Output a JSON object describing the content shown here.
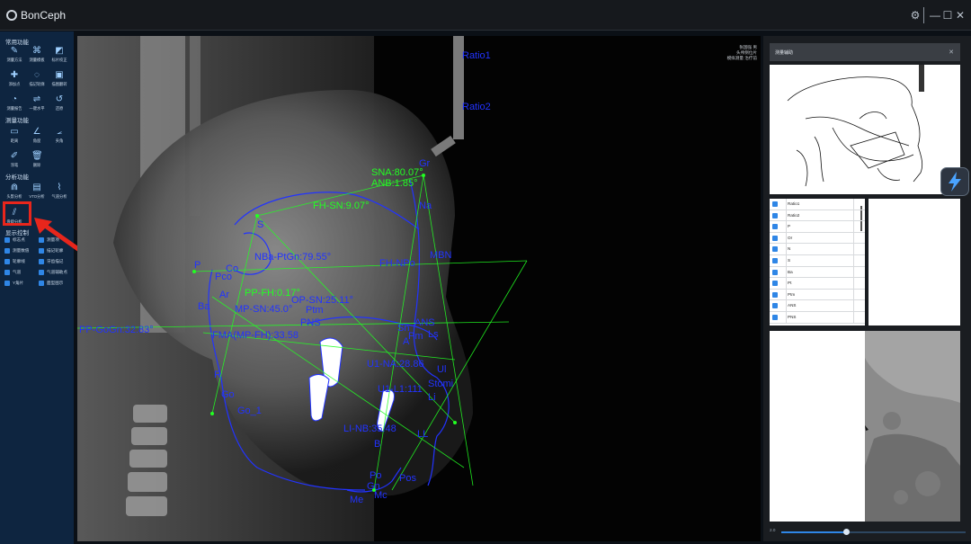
{
  "app": {
    "title": "BonCeph"
  },
  "window_controls": {
    "settings": "⚙",
    "minimize": "—",
    "maximize": "☐",
    "close": "✕"
  },
  "sidebar": {
    "sections": [
      {
        "title": "常用功能",
        "tools": [
          {
            "label": "测量方法",
            "icon": "ruler-set-icon"
          },
          {
            "label": "测量模板",
            "icon": "template-icon"
          },
          {
            "label": "标片校正",
            "icon": "calibrate-icon"
          },
          {
            "label": "添加点",
            "icon": "add-point-icon"
          },
          {
            "label": "描记轮廓",
            "icon": "contour-icon"
          },
          {
            "label": "描图翻转",
            "icon": "flip-icon"
          },
          {
            "label": "测量报告",
            "icon": "report-icon"
          },
          {
            "label": "一键水平",
            "icon": "level-icon"
          },
          {
            "label": "还原",
            "icon": "restore-icon"
          }
        ]
      },
      {
        "title": "测量功能",
        "tools": [
          {
            "label": "距离",
            "icon": "distance-icon"
          },
          {
            "label": "角度",
            "icon": "angle-icon"
          },
          {
            "label": "夹角",
            "icon": "included-angle-icon"
          },
          {
            "label": "涂笔",
            "icon": "pen-icon"
          },
          {
            "label": "删除",
            "icon": "trash-icon"
          }
        ]
      },
      {
        "title": "分析功能",
        "tools": [
          {
            "label": "头影分析",
            "icon": "ceph-analysis-icon"
          },
          {
            "label": "VTO分析",
            "icon": "vto-icon"
          },
          {
            "label": "气道分析",
            "icon": "airway-icon"
          },
          {
            "label": "骨龄分析",
            "icon": "bone-age-icon"
          }
        ]
      }
    ],
    "display": {
      "title": "显示控制",
      "options": [
        "标志点",
        "测量项",
        "测量数值",
        "描记轮廓",
        "轮廓线",
        "牙齿描记",
        "气道",
        "气道辅助点",
        "Y角片",
        "面型图示"
      ]
    }
  },
  "viewer": {
    "info_lines": [
      "张国强 男",
      "头颅侧位片",
      "模拟测量 治疗前"
    ],
    "labels": [
      "Ratio1",
      "Ratio2",
      "SNA:80.07°",
      "ANB:1.85°",
      "Gr",
      "Na",
      "FH-SN:9.07°",
      "S",
      "NBa-PtGn:79.55°",
      "MBN",
      "FH-NPo",
      "P",
      "Co",
      "Pco",
      "Ar",
      "Ba",
      "PP-FH:0.17°",
      "MP-SN:45.0°",
      "OP-SN:25.11°",
      "Ptm",
      "PNS",
      "ANS",
      "Pm",
      "PP-GoGn:32.83°",
      "FMA(MP-FH):33.58",
      "Sn",
      "A",
      "Ls",
      "R",
      "Go",
      "Go_1",
      "U1-NA:28.86",
      "U1-L1:111",
      "Stomi",
      "Ul",
      "Li",
      "LI-NB:35.48",
      "B",
      "LL",
      "Po",
      "Pos",
      "Gn",
      "Me",
      "Mc"
    ]
  },
  "right_panel": {
    "thumbnail_title": "测量辅助",
    "landmarks": [
      "Ratio1",
      "Ratio2",
      "P",
      "Or",
      "N",
      "S",
      "Ba",
      "Pt",
      "Ptm",
      "ANS",
      "PNS"
    ],
    "slider_value": "2.0"
  },
  "colors": {
    "accent": "#2f86e6",
    "sidebar_bg": "#0e2540",
    "highlight": "#e8261c",
    "tracing_blue": "#2233ff",
    "tracing_green": "#22ff22"
  }
}
